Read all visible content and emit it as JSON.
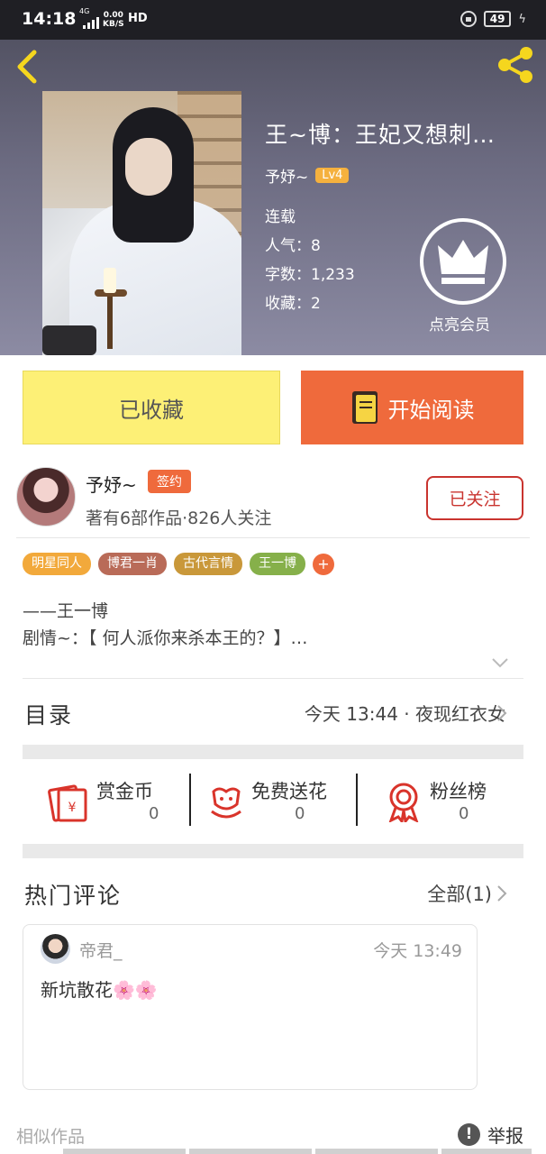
{
  "status_bar": {
    "time": "14:18",
    "network": "4G",
    "speed_value": "0.00",
    "speed_unit": "KB/S",
    "hd": "HD",
    "battery": "49"
  },
  "book": {
    "title": "王~博：王妃又想刺…",
    "author": "予妤~",
    "level": "Lv4",
    "status": "连载",
    "popularity": "人气：8",
    "word_count": "字数：1,233",
    "favorites": "收藏：2",
    "vip_label": "点亮会员"
  },
  "actions": {
    "favorited_label": "已收藏",
    "read_label": "开始阅读"
  },
  "author_card": {
    "name": "予妤~",
    "signed_badge": "签约",
    "stats": "著有6部作品·826人关注",
    "follow_label": "已关注"
  },
  "tags": [
    {
      "label": "明星同人",
      "color": "#f2a93b"
    },
    {
      "label": "博君一肖",
      "color": "#b96b58"
    },
    {
      "label": "古代言情",
      "color": "#c9983a"
    },
    {
      "label": "王一博",
      "color": "#86b04a"
    }
  ],
  "tag_add": "+",
  "synopsis": {
    "line1": "——王一博",
    "line2": "剧情~：【 何人派你来杀本王的？】…"
  },
  "toc": {
    "title": "目录",
    "latest": "今天 13:44 · 夜现红衣女"
  },
  "support": [
    {
      "label": "赏金币",
      "count": "0"
    },
    {
      "label": "免费送花",
      "count": "0"
    },
    {
      "label": "粉丝榜",
      "count": "0"
    }
  ],
  "comments": {
    "title": "热门评论",
    "all_label": "全部(1)",
    "items": [
      {
        "user": "帝君_",
        "time": "今天 13:49",
        "text": "新坑散花🌸🌸"
      }
    ]
  },
  "footer": {
    "similar_label": "相似作品",
    "report_label": "举报"
  },
  "colors": {
    "accent_orange": "#ef6a3c",
    "favorite_yellow": "#fdf076",
    "follow_red": "#c9342f",
    "icon_red": "#d9342b"
  }
}
